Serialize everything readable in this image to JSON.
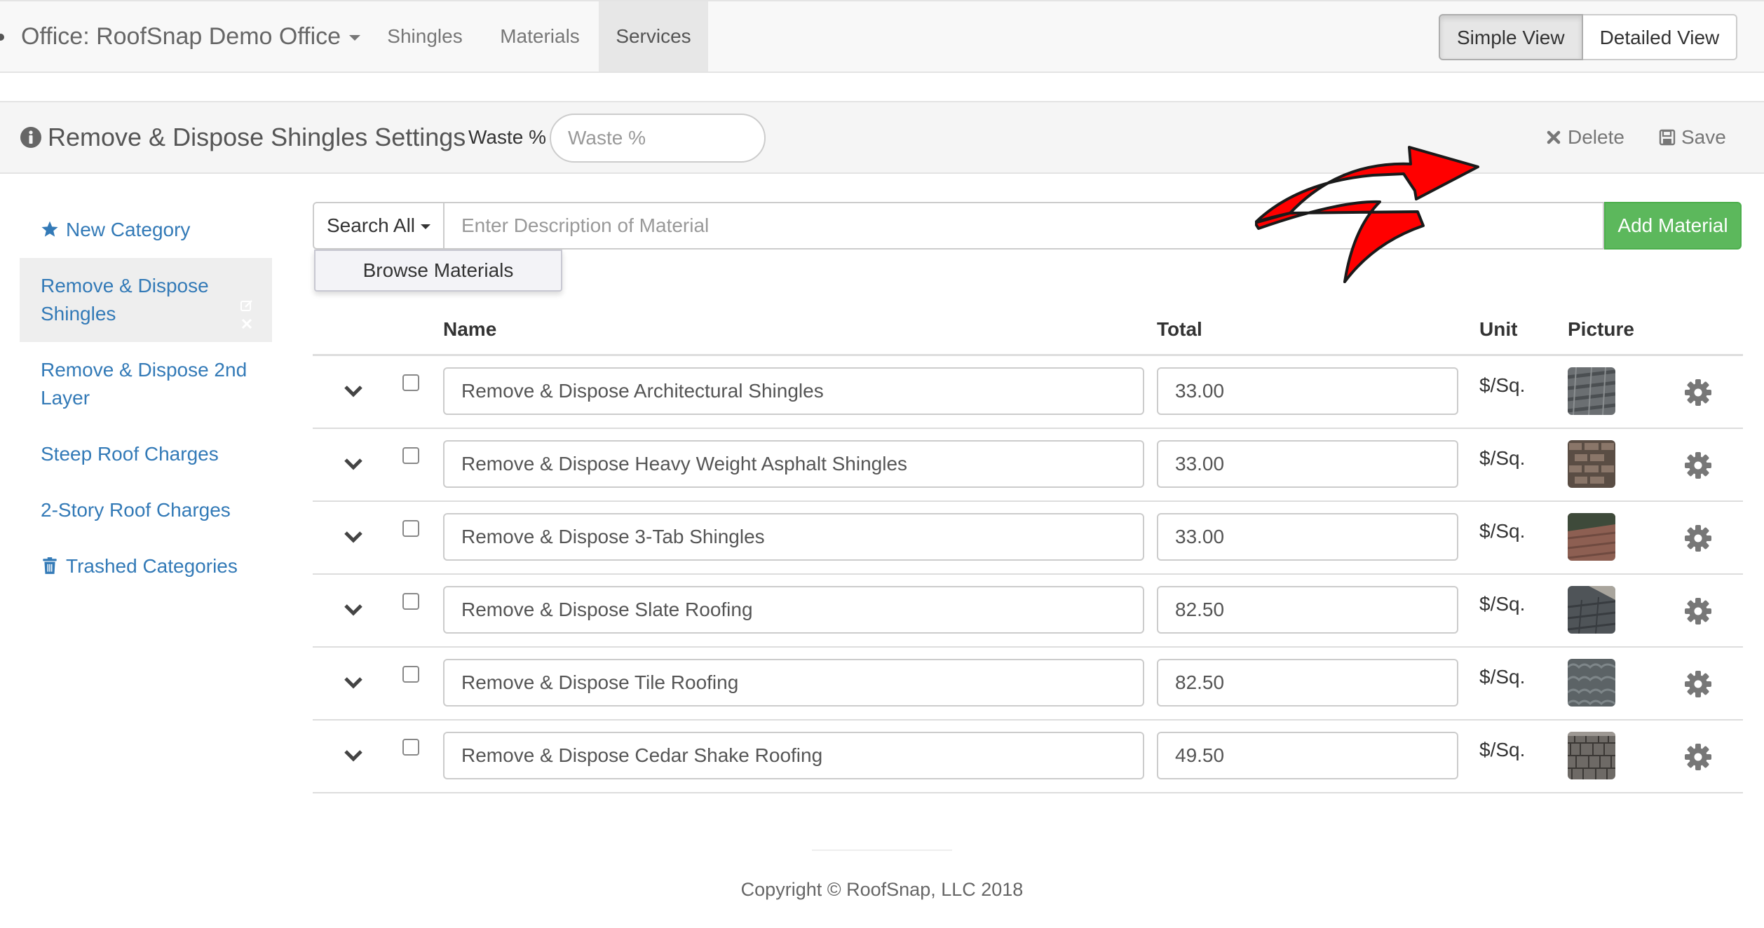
{
  "navbar": {
    "office_label": "Office: RoofSnap Demo Office",
    "tabs": [
      {
        "label": "Shingles",
        "active": false
      },
      {
        "label": "Materials",
        "active": false
      },
      {
        "label": "Services",
        "active": true
      }
    ],
    "view_toggle": {
      "simple": "Simple View",
      "detailed": "Detailed View",
      "selected": "Simple View"
    }
  },
  "settings": {
    "title": "Remove & Dispose Shingles Settings",
    "waste_label": "Waste %",
    "waste_placeholder": "Waste %",
    "waste_value": "",
    "delete_label": "Delete",
    "save_label": "Save"
  },
  "sidebar": {
    "new_category": "New Category",
    "categories": [
      {
        "label": "Remove & Dispose Shingles",
        "active": true
      },
      {
        "label": "Remove & Dispose 2nd Layer",
        "active": false
      },
      {
        "label": "Steep Roof Charges",
        "active": false
      },
      {
        "label": "2-Story Roof Charges",
        "active": false
      }
    ],
    "trashed": "Trashed Categories"
  },
  "search": {
    "scope_label": "Search All",
    "placeholder": "Enter Description of Material",
    "add_label": "Add Material",
    "browse_label": "Browse Materials"
  },
  "table": {
    "headers": {
      "name": "Name",
      "total": "Total",
      "unit": "Unit",
      "picture": "Picture"
    },
    "rows": [
      {
        "name": "Remove & Dispose Architectural Shingles",
        "total": "33.00",
        "unit": "$/Sq.",
        "picture": "architectural-shingles-thumb"
      },
      {
        "name": "Remove & Dispose Heavy Weight Asphalt Shingles",
        "total": "33.00",
        "unit": "$/Sq.",
        "picture": "asphalt-shingles-thumb"
      },
      {
        "name": "Remove & Dispose 3-Tab Shingles",
        "total": "33.00",
        "unit": "$/Sq.",
        "picture": "3-tab-shingles-thumb"
      },
      {
        "name": "Remove & Dispose Slate Roofing",
        "total": "82.50",
        "unit": "$/Sq.",
        "picture": "slate-roofing-thumb"
      },
      {
        "name": "Remove & Dispose Tile Roofing",
        "total": "82.50",
        "unit": "$/Sq.",
        "picture": "tile-roofing-thumb"
      },
      {
        "name": "Remove & Dispose Cedar Shake Roofing",
        "total": "49.50",
        "unit": "$/Sq.",
        "picture": "cedar-shake-thumb"
      }
    ]
  },
  "footer": {
    "copyright": "Copyright © RoofSnap, LLC 2018"
  },
  "colors": {
    "link": "#337ab7",
    "success": "#5cb85c",
    "annotation_arrow": "#ff0000"
  }
}
